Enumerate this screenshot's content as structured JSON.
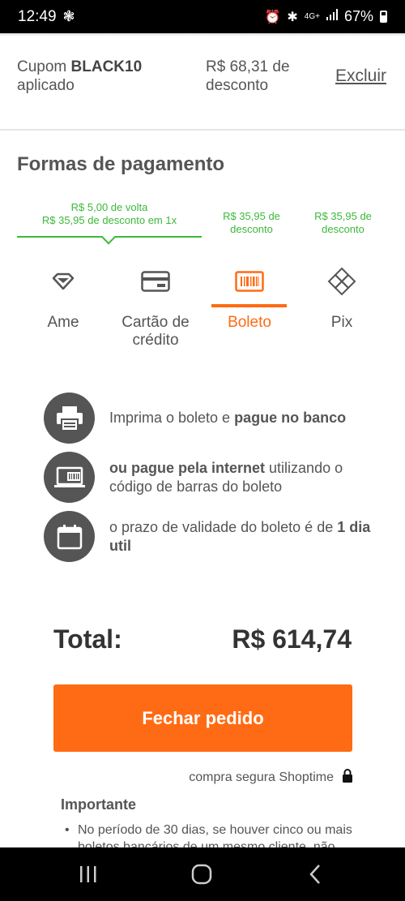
{
  "status_bar": {
    "time": "12:49",
    "notification_icon": "pinwheel-icon",
    "battery": "67%",
    "signal_text": "4G+"
  },
  "coupon": {
    "prefix": "Cupom",
    "code": "BLACK10",
    "suffix": "aplicado",
    "discount": "R$ 68,31 de desconto",
    "remove_label": "Excluir"
  },
  "payment": {
    "title": "Formas de pagamento",
    "promos": {
      "ame_line1": "R$ 5,00 de volta",
      "ame_line2": "R$ 35,95 de desconto em 1x",
      "boleto": "R$ 35,95 de desconto",
      "pix": "R$ 35,95 de desconto"
    },
    "methods": [
      {
        "label": "Ame",
        "icon": "heart-diamond-icon",
        "active": false
      },
      {
        "label": "Cartão de crédito",
        "icon": "credit-card-icon",
        "active": false
      },
      {
        "label": "Boleto",
        "icon": "barcode-icon",
        "active": true
      },
      {
        "label": "Pix",
        "icon": "pix-icon",
        "active": false
      }
    ],
    "accent_color": "#ff6b14",
    "promo_color": "#3db83a"
  },
  "boleto_info": {
    "row1_plain": "Imprima o boleto e ",
    "row1_bold": "pague no banco",
    "row2_bold": "ou pague pela internet",
    "row2_plain": " utilizando o código de barras do boleto",
    "row3_plain": "o prazo de validade do boleto é de ",
    "row3_bold": "1 dia util"
  },
  "total": {
    "label": "Total:",
    "value": "R$ 614,74"
  },
  "checkout": {
    "button_label": "Fechar pedido",
    "secure_text": "compra segura Shoptime"
  },
  "important": {
    "title": "Importante",
    "text": "No período de 30 dias, se houver cinco ou mais boletos bancários de um mesmo cliente, não"
  }
}
